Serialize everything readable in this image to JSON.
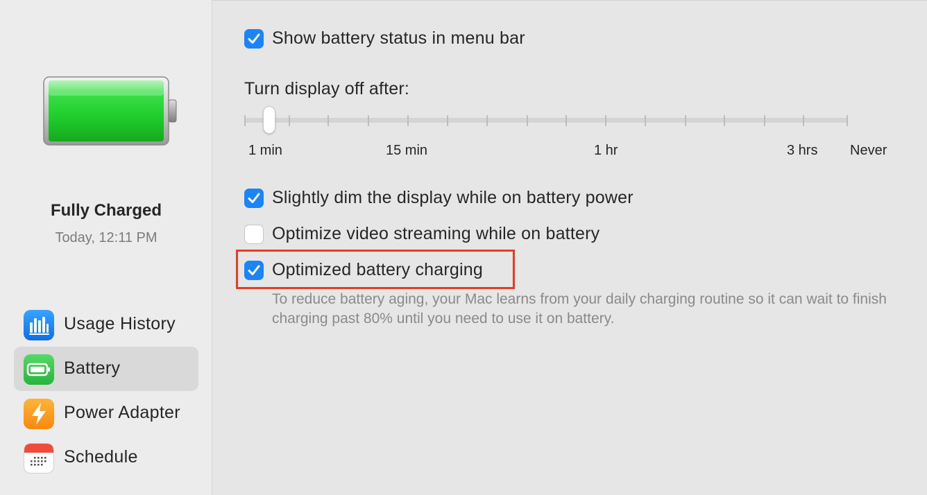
{
  "sidebar": {
    "status_title": "Fully Charged",
    "status_time": "Today, 12:11 PM",
    "items": [
      {
        "label": "Usage History",
        "icon": "bar-chart-icon",
        "selected": false
      },
      {
        "label": "Battery",
        "icon": "battery-icon",
        "selected": true
      },
      {
        "label": "Power Adapter",
        "icon": "lightning-bolt-icon",
        "selected": false
      },
      {
        "label": "Schedule",
        "icon": "calendar-icon",
        "selected": false
      }
    ]
  },
  "options": {
    "show_status": {
      "label": "Show battery status in menu bar",
      "checked": true
    },
    "dim_display": {
      "label": "Slightly dim the display while on battery power",
      "checked": true
    },
    "optimize_video": {
      "label": "Optimize video streaming while on battery",
      "checked": false
    },
    "optimized_charging": {
      "label": "Optimized battery charging",
      "checked": true,
      "description": "To reduce battery aging, your Mac learns from your daily charging routine so it can wait to finish charging past 80% until you need to use it on battery."
    }
  },
  "display_off": {
    "label": "Turn display off after:",
    "value": "1 min",
    "tick_labels": [
      "1 min",
      "15 min",
      "1 hr",
      "3 hrs",
      "Never"
    ]
  },
  "colors": {
    "accent": "#1b84f7",
    "highlight": "#e53c28",
    "battery_green": "#2fd63b"
  }
}
